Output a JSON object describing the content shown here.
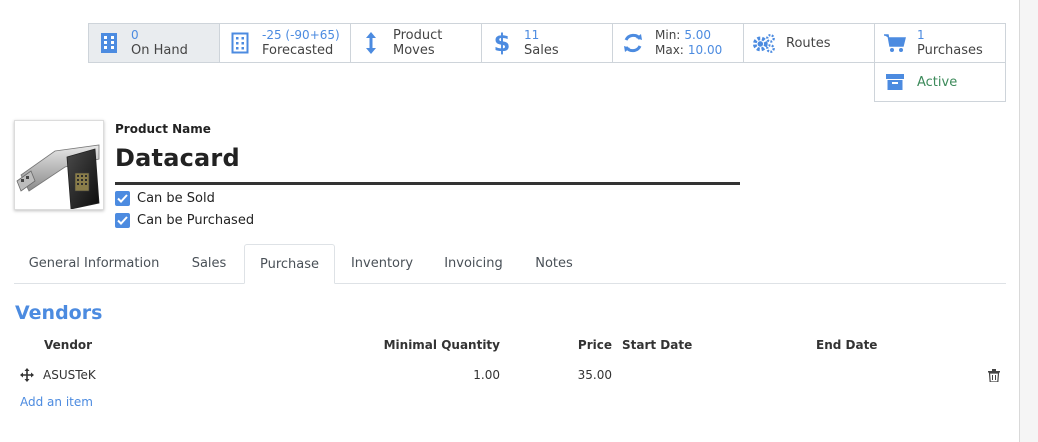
{
  "stat_buttons": {
    "on_hand": {
      "value": "0",
      "label": "On Hand"
    },
    "forecasted": {
      "value": "-25 (-90+65)",
      "label": "Forecasted"
    },
    "product_moves": {
      "line1": "Product",
      "line2": "Moves"
    },
    "sales": {
      "value": "11",
      "label": "Sales"
    },
    "minmax": {
      "min_label": "Min:",
      "min_value": "5.00",
      "max_label": "Max:",
      "max_value": "10.00"
    },
    "routes": {
      "label": "Routes"
    },
    "purchases": {
      "value": "1",
      "label": "Purchases"
    },
    "active": {
      "label": "Active"
    }
  },
  "product": {
    "name_label": "Product Name",
    "name": "Datacard",
    "can_be_sold": "Can be Sold",
    "can_be_purchased": "Can be Purchased"
  },
  "tabs": [
    "General Information",
    "Sales",
    "Purchase",
    "Inventory",
    "Invoicing",
    "Notes"
  ],
  "active_tab": "Purchase",
  "vendors": {
    "title": "Vendors",
    "columns": {
      "vendor": "Vendor",
      "min_qty": "Minimal Quantity",
      "price": "Price",
      "start": "Start Date",
      "end": "End Date"
    },
    "rows": [
      {
        "vendor": "ASUSTeK",
        "min_qty": "1.00",
        "price": "35.00",
        "start": "",
        "end": ""
      }
    ],
    "add_item": "Add an item"
  },
  "colors": {
    "accent": "#4c8be0",
    "active_green": "#3c8a5a"
  },
  "icons": [
    "building-icon",
    "building-icon",
    "updown-arrows-icon",
    "dollar-icon",
    "refresh-icon",
    "gears-icon",
    "cart-icon",
    "archive-icon",
    "move-handle-icon",
    "trash-icon",
    "checkbox-icon"
  ]
}
